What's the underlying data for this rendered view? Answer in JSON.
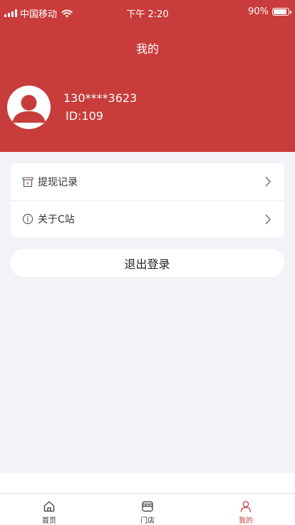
{
  "status_bar": {
    "carrier": "中国移动",
    "time": "下午 2:20",
    "battery": "90%",
    "battery_level": 0.9
  },
  "header": {
    "title": "我的",
    "background_color": "#c83c3b"
  },
  "user": {
    "phone": "130****3623",
    "id": "ID:109",
    "avatar_icon": "person-icon"
  },
  "menu": {
    "items": [
      {
        "label": "提现记录",
        "icon": "withdraw-record-icon"
      },
      {
        "label": "关于C站",
        "icon": "info-icon"
      }
    ]
  },
  "logout": {
    "label": "退出登录"
  },
  "tabbar": {
    "active_color": "#c83c3b",
    "items": [
      {
        "label": "首页",
        "icon": "home-icon"
      },
      {
        "label": "门店",
        "icon": "store-icon"
      },
      {
        "label": "我的",
        "icon": "user-icon",
        "active": true
      }
    ]
  }
}
